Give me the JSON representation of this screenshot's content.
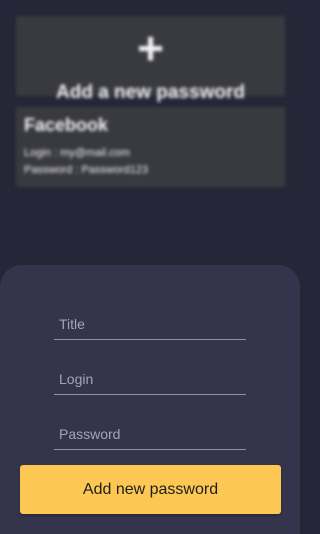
{
  "add_card": {
    "icon": "plus-icon",
    "glyph": "+",
    "label": "Add a new password"
  },
  "entries": [
    {
      "title": "Facebook",
      "login_line": "Login : my@mail.com",
      "password_line": "Password : Password123"
    }
  ],
  "form": {
    "title_placeholder": "Title",
    "login_placeholder": "Login",
    "password_placeholder": "Password",
    "submit_label": "Add new password"
  },
  "colors": {
    "background": "#252637",
    "card": "#393a40",
    "sheet": "#34354c",
    "accent": "#fcc853"
  }
}
